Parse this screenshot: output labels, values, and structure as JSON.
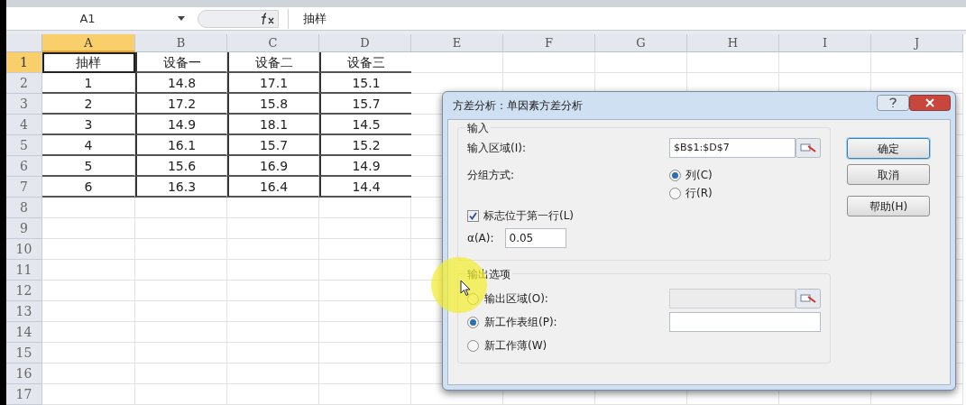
{
  "formula_bar": {
    "name_box": "A1",
    "content": "抽样"
  },
  "sheet": {
    "columns": [
      {
        "label": "A",
        "selected": true
      },
      {
        "label": "B",
        "selected": false
      },
      {
        "label": "C",
        "selected": false
      },
      {
        "label": "D",
        "selected": false
      },
      {
        "label": "E",
        "selected": false
      },
      {
        "label": "F",
        "selected": false
      },
      {
        "label": "G",
        "selected": false
      },
      {
        "label": "H",
        "selected": false
      },
      {
        "label": "I",
        "selected": false
      },
      {
        "label": "J",
        "selected": false
      }
    ],
    "rows": [
      {
        "label": "1",
        "selected": true,
        "cells": [
          "抽样",
          "设备一",
          "设备二",
          "设备三"
        ]
      },
      {
        "label": "2",
        "selected": false,
        "cells": [
          "1",
          "14.8",
          "17.1",
          "15.1"
        ]
      },
      {
        "label": "3",
        "selected": false,
        "cells": [
          "2",
          "17.2",
          "15.8",
          "15.7"
        ]
      },
      {
        "label": "4",
        "selected": false,
        "cells": [
          "3",
          "14.9",
          "18.1",
          "14.5"
        ]
      },
      {
        "label": "5",
        "selected": false,
        "cells": [
          "4",
          "16.1",
          "15.7",
          "15.2"
        ]
      },
      {
        "label": "6",
        "selected": false,
        "cells": [
          "5",
          "15.6",
          "16.9",
          "14.9"
        ]
      },
      {
        "label": "7",
        "selected": false,
        "cells": [
          "6",
          "16.3",
          "16.4",
          "14.4"
        ]
      },
      {
        "label": "8",
        "selected": false
      },
      {
        "label": "9",
        "selected": false
      },
      {
        "label": "10",
        "selected": false
      },
      {
        "label": "11",
        "selected": false
      },
      {
        "label": "12",
        "selected": false
      },
      {
        "label": "13",
        "selected": false
      },
      {
        "label": "14",
        "selected": false
      },
      {
        "label": "15",
        "selected": false
      },
      {
        "label": "16",
        "selected": false
      },
      {
        "label": "17",
        "selected": false
      }
    ]
  },
  "dialog": {
    "title": "方差分析：单因素方差分析",
    "input_group": {
      "title": "输入",
      "range_label": "输入区域(I):",
      "range_value": "$B$1:$D$7",
      "group_by_label": "分组方式:",
      "group_by_options": [
        {
          "label": "列(C)",
          "selected": true
        },
        {
          "label": "行(R)",
          "selected": false
        }
      ],
      "labels_in_first_row": {
        "label": "标志位于第一行(L)",
        "checked": true
      },
      "alpha_label": "α(A):",
      "alpha_value": "0.05"
    },
    "output_group": {
      "title": "输出选项",
      "options": [
        {
          "label": "输出区域(O):",
          "selected": false,
          "kind": "range"
        },
        {
          "label": "新工作表组(P):",
          "selected": true,
          "kind": "text"
        },
        {
          "label": "新工作薄(W)",
          "selected": false,
          "kind": "plain"
        }
      ]
    },
    "buttons": [
      "确定",
      "取消",
      "帮助(H)"
    ]
  }
}
